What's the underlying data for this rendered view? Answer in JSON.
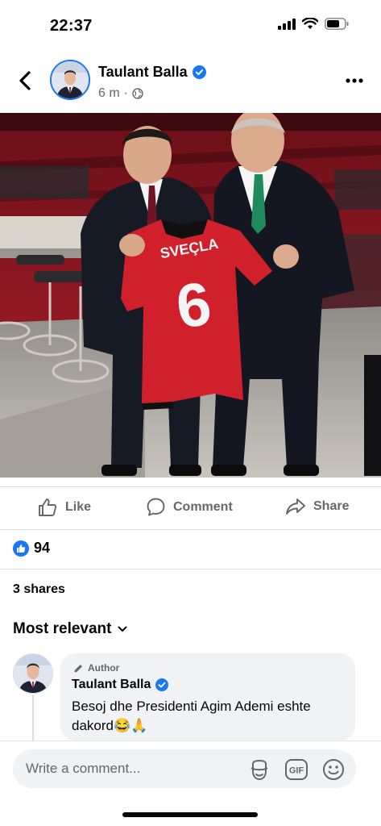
{
  "status_bar": {
    "time": "22:37",
    "icons": [
      "signal-icon",
      "wifi-icon",
      "battery-icon"
    ]
  },
  "header": {
    "back_icon": "back-chevron-icon",
    "author_name": "Taulant Balla",
    "verified_icon": "verified-badge-icon",
    "time_ago": "6 m",
    "separator": "·",
    "privacy_icon": "globe-icon",
    "more_icon": "more-dots-icon"
  },
  "photo": {
    "jersey_name": "SVEÇLA",
    "jersey_number": "6"
  },
  "actions": {
    "like_label": "Like",
    "comment_label": "Comment",
    "share_label": "Share"
  },
  "reactions": {
    "count": "94",
    "icon": "like-reaction-icon"
  },
  "shares_text": "3 shares",
  "filter": {
    "label": "Most relevant",
    "icon": "chevron-down-icon"
  },
  "comment": {
    "author_tag": "Author",
    "author_name": "Taulant Balla",
    "text": "Besoj dhe Presidenti Agim Ademi eshte dakord😂🙏"
  },
  "composer": {
    "placeholder": "Write a comment...",
    "icons": [
      "sticker-icon",
      "gif-icon",
      "emoji-icon"
    ],
    "gif_label": "GIF"
  },
  "colors": {
    "accent": "#1877f2",
    "secondary_text": "#65676b",
    "bubble": "#f0f2f5",
    "jersey_red": "#d0202c"
  }
}
